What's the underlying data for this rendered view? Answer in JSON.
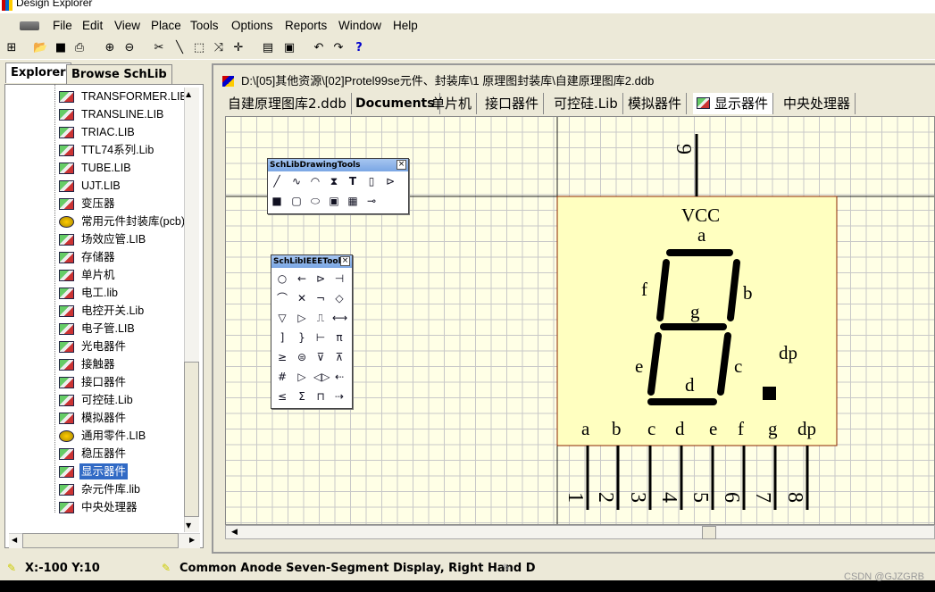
{
  "window": {
    "title": "Design Explorer"
  },
  "menu": [
    "File",
    "Edit",
    "View",
    "Place",
    "Tools",
    "Options",
    "Reports",
    "Window",
    "Help"
  ],
  "left_tabs": {
    "explorer": "Explorer",
    "browse": "Browse SchLib"
  },
  "tree_items": [
    {
      "label": "TRANSFORMER.LIB",
      "icon": "lib"
    },
    {
      "label": "TRANSLINE.LIB",
      "icon": "lib"
    },
    {
      "label": "TRIAC.LIB",
      "icon": "lib"
    },
    {
      "label": "TTL74系列.Lib",
      "icon": "lib"
    },
    {
      "label": "TUBE.LIB",
      "icon": "lib"
    },
    {
      "label": "UJT.LIB",
      "icon": "lib"
    },
    {
      "label": "变压器",
      "icon": "lib"
    },
    {
      "label": "常用元件封装库(pcb).",
      "icon": "pcb"
    },
    {
      "label": "场效应管.LIB",
      "icon": "lib"
    },
    {
      "label": "存储器",
      "icon": "lib"
    },
    {
      "label": "单片机",
      "icon": "lib"
    },
    {
      "label": "电工.lib",
      "icon": "lib"
    },
    {
      "label": "电控开关.Lib",
      "icon": "lib"
    },
    {
      "label": "电子管.LIB",
      "icon": "lib"
    },
    {
      "label": "光电器件",
      "icon": "lib"
    },
    {
      "label": "接触器",
      "icon": "lib"
    },
    {
      "label": "接口器件",
      "icon": "lib"
    },
    {
      "label": "可控硅.Lib",
      "icon": "lib"
    },
    {
      "label": "模拟器件",
      "icon": "lib"
    },
    {
      "label": "通用零件.LIB",
      "icon": "pcb"
    },
    {
      "label": "稳压器件",
      "icon": "lib"
    },
    {
      "label": "显示器件",
      "icon": "lib",
      "selected": true
    },
    {
      "label": "杂元件库.lib",
      "icon": "lib"
    },
    {
      "label": "中央处理器",
      "icon": "lib"
    }
  ],
  "document": {
    "path": "D:\\[05]其他资源\\[02]Protel99se元件、封装库\\1 原理图封装库\\自建原理图库2.ddb",
    "tabs": [
      {
        "label": "自建原理图库2.ddb",
        "bold": false
      },
      {
        "label": "Documents",
        "bold": true
      },
      {
        "label": "单片机",
        "bold": false
      },
      {
        "label": "接口器件",
        "bold": false
      },
      {
        "label": "可控硅.Lib",
        "bold": false
      },
      {
        "label": "模拟器件",
        "bold": false
      },
      {
        "label": "显示器件",
        "bold": false,
        "active": true
      },
      {
        "label": "中央处理器",
        "bold": false
      }
    ]
  },
  "palettes": {
    "drawing": {
      "title": "SchLibDrawingTools"
    },
    "ieee": {
      "title": "SchLibIEEETools"
    }
  },
  "component": {
    "vcc": "VCC",
    "pin_top": "9",
    "segments": {
      "a": "a",
      "b": "b",
      "c": "c",
      "d": "d",
      "e": "e",
      "f": "f",
      "g": "g",
      "dp": "dp"
    },
    "pin_labels": [
      "a",
      "b",
      "c",
      "d",
      "e",
      "f",
      "g",
      "dp"
    ],
    "pin_numbers": [
      "1",
      "2",
      "3",
      "4",
      "5",
      "6",
      "7",
      "8"
    ],
    "body_color": "#ffffc0",
    "body_border": "#8b2500"
  },
  "status": {
    "coords": "X:-100 Y:10",
    "description": "Common Anode Seven-Segment Display, Right Hand D"
  },
  "watermark": "CSDN @GJZGRB"
}
